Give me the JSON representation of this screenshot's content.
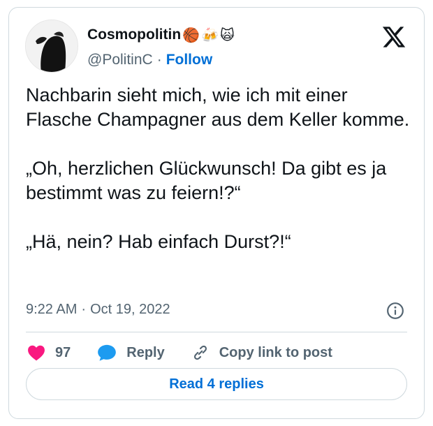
{
  "author": {
    "display_name": "Cosmopolitin",
    "emojis": [
      "🏀",
      "🍻",
      "🙀"
    ],
    "handle": "@PolitinC",
    "separator": "·",
    "follow_label": "Follow"
  },
  "tweet": {
    "paragraphs": [
      "Nachbarin sieht mich, wie ich mit einer Flasche Champagner aus dem Keller komme.",
      "„Oh, herzlichen Glückwunsch! Da gibt es ja bestimmt was zu feiern!?“",
      "„Hä, nein? Hab einfach Durst?!“"
    ],
    "time": "9:22 AM",
    "date_separator": "·",
    "date": "Oct 19, 2022"
  },
  "actions": {
    "like_count": "97",
    "reply_label": "Reply",
    "copy_link_label": "Copy link to post"
  },
  "footer": {
    "read_replies_label": "Read 4 replies"
  },
  "colors": {
    "like": "#f91880",
    "reply": "#1d9bf0",
    "link": "#006fd6",
    "muted": "#536471",
    "border": "#cfd9de"
  },
  "icons": [
    "x-logo-icon",
    "info-icon",
    "heart-icon",
    "reply-bubble-icon",
    "link-icon"
  ]
}
